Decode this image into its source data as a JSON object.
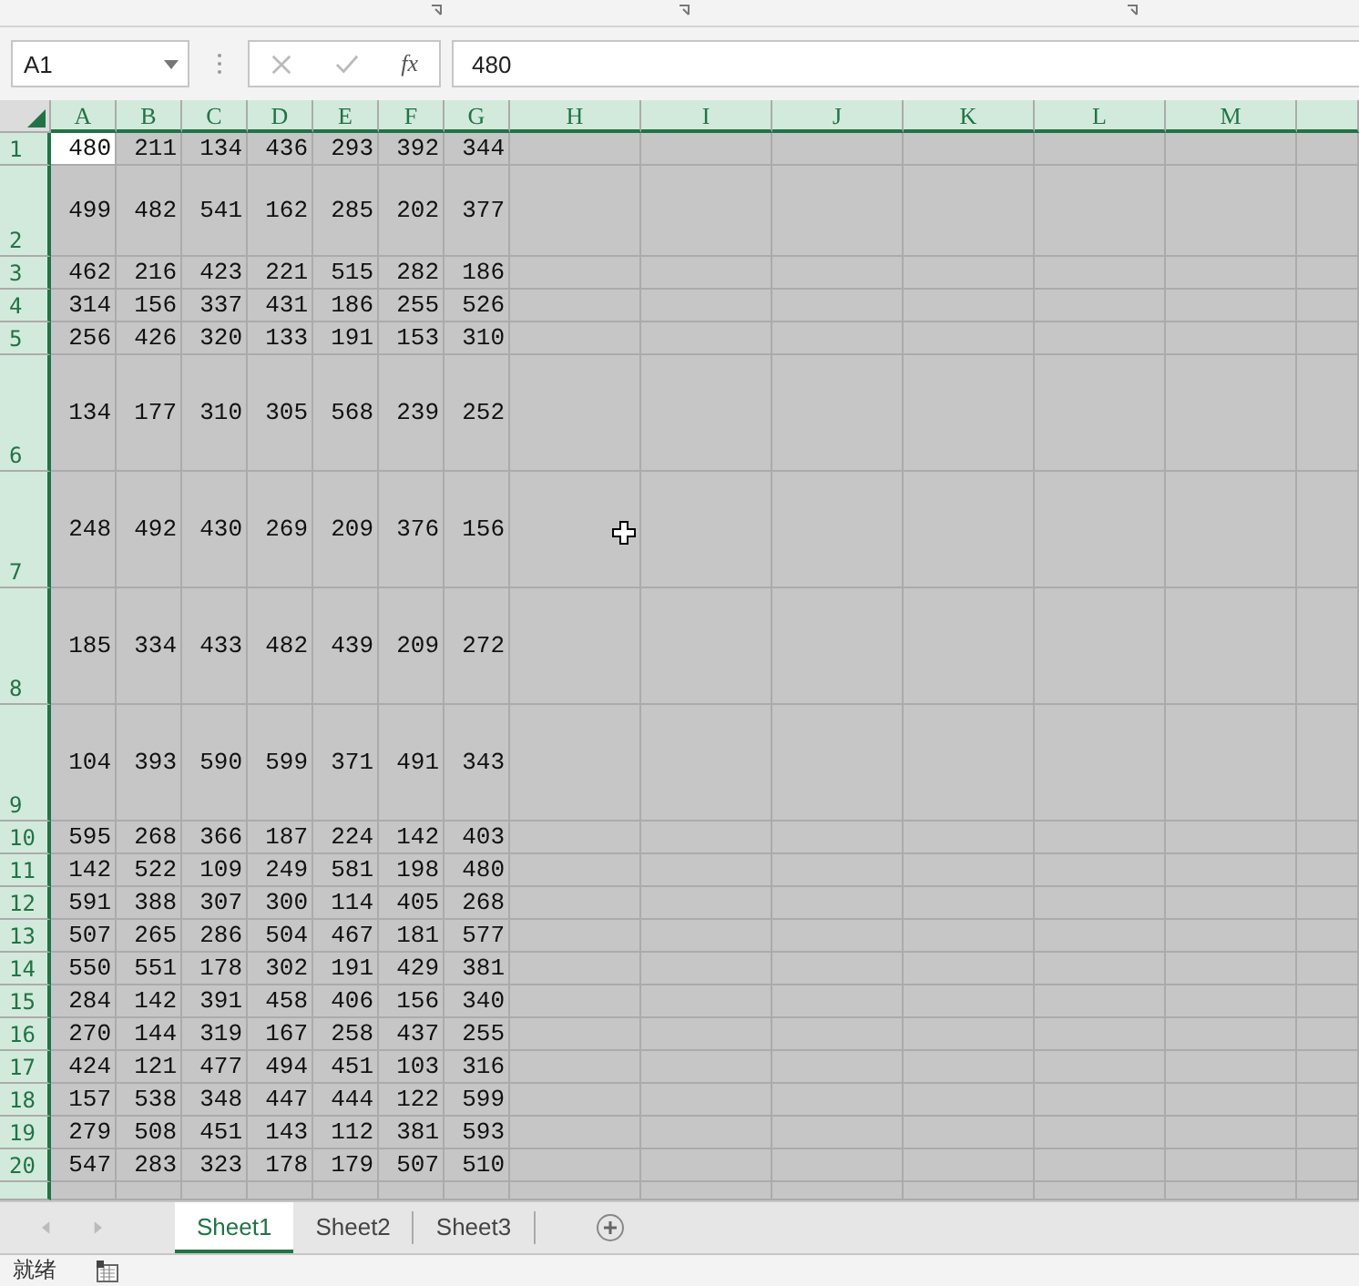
{
  "name_box": {
    "value": "A1"
  },
  "formula_bar": {
    "function_label": "fx",
    "value": "480"
  },
  "grid": {
    "all_selected": true,
    "columns": [
      "A",
      "B",
      "C",
      "D",
      "E",
      "F",
      "G",
      "H",
      "I",
      "J",
      "K",
      "L",
      "M"
    ],
    "rows": [
      {
        "label": "1",
        "kind": "normal",
        "cells": [
          {
            "value": "480",
            "active": true
          },
          {
            "value": "211",
            "active": false
          },
          {
            "value": "134",
            "active": false
          },
          {
            "value": "436",
            "active": false
          },
          {
            "value": "293",
            "active": false
          },
          {
            "value": "392",
            "active": false
          },
          {
            "value": "344",
            "active": false
          }
        ]
      },
      {
        "label": "2",
        "kind": "medium",
        "cells": [
          {
            "value": "499",
            "active": false
          },
          {
            "value": "482",
            "active": false
          },
          {
            "value": "541",
            "active": false
          },
          {
            "value": "162",
            "active": false
          },
          {
            "value": "285",
            "active": false
          },
          {
            "value": "202",
            "active": false
          },
          {
            "value": "377",
            "active": false
          }
        ]
      },
      {
        "label": "3",
        "kind": "normal",
        "cells": [
          {
            "value": "462",
            "active": false
          },
          {
            "value": "216",
            "active": false
          },
          {
            "value": "423",
            "active": false
          },
          {
            "value": "221",
            "active": false
          },
          {
            "value": "515",
            "active": false
          },
          {
            "value": "282",
            "active": false
          },
          {
            "value": "186",
            "active": false
          }
        ]
      },
      {
        "label": "4",
        "kind": "normal",
        "cells": [
          {
            "value": "314",
            "active": false
          },
          {
            "value": "156",
            "active": false
          },
          {
            "value": "337",
            "active": false
          },
          {
            "value": "431",
            "active": false
          },
          {
            "value": "186",
            "active": false
          },
          {
            "value": "255",
            "active": false
          },
          {
            "value": "526",
            "active": false
          }
        ]
      },
      {
        "label": "5",
        "kind": "normal",
        "cells": [
          {
            "value": "256",
            "active": false
          },
          {
            "value": "426",
            "active": false
          },
          {
            "value": "320",
            "active": false
          },
          {
            "value": "133",
            "active": false
          },
          {
            "value": "191",
            "active": false
          },
          {
            "value": "153",
            "active": false
          },
          {
            "value": "310",
            "active": false
          }
        ]
      },
      {
        "label": "6",
        "kind": "tall",
        "cells": [
          {
            "value": "134",
            "active": false
          },
          {
            "value": "177",
            "active": false
          },
          {
            "value": "310",
            "active": false
          },
          {
            "value": "305",
            "active": false
          },
          {
            "value": "568",
            "active": false
          },
          {
            "value": "239",
            "active": false
          },
          {
            "value": "252",
            "active": false
          }
        ]
      },
      {
        "label": "7",
        "kind": "tall",
        "cells": [
          {
            "value": "248",
            "active": false
          },
          {
            "value": "492",
            "active": false
          },
          {
            "value": "430",
            "active": false
          },
          {
            "value": "269",
            "active": false
          },
          {
            "value": "209",
            "active": false
          },
          {
            "value": "376",
            "active": false
          },
          {
            "value": "156",
            "active": false
          }
        ]
      },
      {
        "label": "8",
        "kind": "tall",
        "cells": [
          {
            "value": "185",
            "active": false
          },
          {
            "value": "334",
            "active": false
          },
          {
            "value": "433",
            "active": false
          },
          {
            "value": "482",
            "active": false
          },
          {
            "value": "439",
            "active": false
          },
          {
            "value": "209",
            "active": false
          },
          {
            "value": "272",
            "active": false
          }
        ]
      },
      {
        "label": "9",
        "kind": "tall",
        "cells": [
          {
            "value": "104",
            "active": false
          },
          {
            "value": "393",
            "active": false
          },
          {
            "value": "590",
            "active": false
          },
          {
            "value": "599",
            "active": false
          },
          {
            "value": "371",
            "active": false
          },
          {
            "value": "491",
            "active": false
          },
          {
            "value": "343",
            "active": false
          }
        ]
      },
      {
        "label": "10",
        "kind": "normal",
        "cells": [
          {
            "value": "595",
            "active": false
          },
          {
            "value": "268",
            "active": false
          },
          {
            "value": "366",
            "active": false
          },
          {
            "value": "187",
            "active": false
          },
          {
            "value": "224",
            "active": false
          },
          {
            "value": "142",
            "active": false
          },
          {
            "value": "403",
            "active": false
          }
        ]
      },
      {
        "label": "11",
        "kind": "normal",
        "cells": [
          {
            "value": "142",
            "active": false
          },
          {
            "value": "522",
            "active": false
          },
          {
            "value": "109",
            "active": false
          },
          {
            "value": "249",
            "active": false
          },
          {
            "value": "581",
            "active": false
          },
          {
            "value": "198",
            "active": false
          },
          {
            "value": "480",
            "active": false
          }
        ]
      },
      {
        "label": "12",
        "kind": "normal",
        "cells": [
          {
            "value": "591",
            "active": false
          },
          {
            "value": "388",
            "active": false
          },
          {
            "value": "307",
            "active": false
          },
          {
            "value": "300",
            "active": false
          },
          {
            "value": "114",
            "active": false
          },
          {
            "value": "405",
            "active": false
          },
          {
            "value": "268",
            "active": false
          }
        ]
      },
      {
        "label": "13",
        "kind": "normal",
        "cells": [
          {
            "value": "507",
            "active": false
          },
          {
            "value": "265",
            "active": false
          },
          {
            "value": "286",
            "active": false
          },
          {
            "value": "504",
            "active": false
          },
          {
            "value": "467",
            "active": false
          },
          {
            "value": "181",
            "active": false
          },
          {
            "value": "577",
            "active": false
          }
        ]
      },
      {
        "label": "14",
        "kind": "normal",
        "cells": [
          {
            "value": "550",
            "active": false
          },
          {
            "value": "551",
            "active": false
          },
          {
            "value": "178",
            "active": false
          },
          {
            "value": "302",
            "active": false
          },
          {
            "value": "191",
            "active": false
          },
          {
            "value": "429",
            "active": false
          },
          {
            "value": "381",
            "active": false
          }
        ]
      },
      {
        "label": "15",
        "kind": "normal",
        "cells": [
          {
            "value": "284",
            "active": false
          },
          {
            "value": "142",
            "active": false
          },
          {
            "value": "391",
            "active": false
          },
          {
            "value": "458",
            "active": false
          },
          {
            "value": "406",
            "active": false
          },
          {
            "value": "156",
            "active": false
          },
          {
            "value": "340",
            "active": false
          }
        ]
      },
      {
        "label": "16",
        "kind": "normal",
        "cells": [
          {
            "value": "270",
            "active": false
          },
          {
            "value": "144",
            "active": false
          },
          {
            "value": "319",
            "active": false
          },
          {
            "value": "167",
            "active": false
          },
          {
            "value": "258",
            "active": false
          },
          {
            "value": "437",
            "active": false
          },
          {
            "value": "255",
            "active": false
          }
        ]
      },
      {
        "label": "17",
        "kind": "normal",
        "cells": [
          {
            "value": "424",
            "active": false
          },
          {
            "value": "121",
            "active": false
          },
          {
            "value": "477",
            "active": false
          },
          {
            "value": "494",
            "active": false
          },
          {
            "value": "451",
            "active": false
          },
          {
            "value": "103",
            "active": false
          },
          {
            "value": "316",
            "active": false
          }
        ]
      },
      {
        "label": "18",
        "kind": "normal",
        "cells": [
          {
            "value": "157",
            "active": false
          },
          {
            "value": "538",
            "active": false
          },
          {
            "value": "348",
            "active": false
          },
          {
            "value": "447",
            "active": false
          },
          {
            "value": "444",
            "active": false
          },
          {
            "value": "122",
            "active": false
          },
          {
            "value": "599",
            "active": false
          }
        ]
      },
      {
        "label": "19",
        "kind": "normal",
        "cells": [
          {
            "value": "279",
            "active": false
          },
          {
            "value": "508",
            "active": false
          },
          {
            "value": "451",
            "active": false
          },
          {
            "value": "143",
            "active": false
          },
          {
            "value": "112",
            "active": false
          },
          {
            "value": "381",
            "active": false
          },
          {
            "value": "593",
            "active": false
          }
        ]
      },
      {
        "label": "20",
        "kind": "normal",
        "cells": [
          {
            "value": "547",
            "active": false
          },
          {
            "value": "283",
            "active": false
          },
          {
            "value": "323",
            "active": false
          },
          {
            "value": "178",
            "active": false
          },
          {
            "value": "179",
            "active": false
          },
          {
            "value": "507",
            "active": false
          },
          {
            "value": "510",
            "active": false
          }
        ]
      }
    ]
  },
  "sheet_tabs": [
    {
      "label": "Sheet1",
      "selected": true
    },
    {
      "label": "Sheet2",
      "selected": false
    },
    {
      "label": "Sheet3",
      "selected": false
    }
  ],
  "status_bar": {
    "text": "就绪"
  }
}
